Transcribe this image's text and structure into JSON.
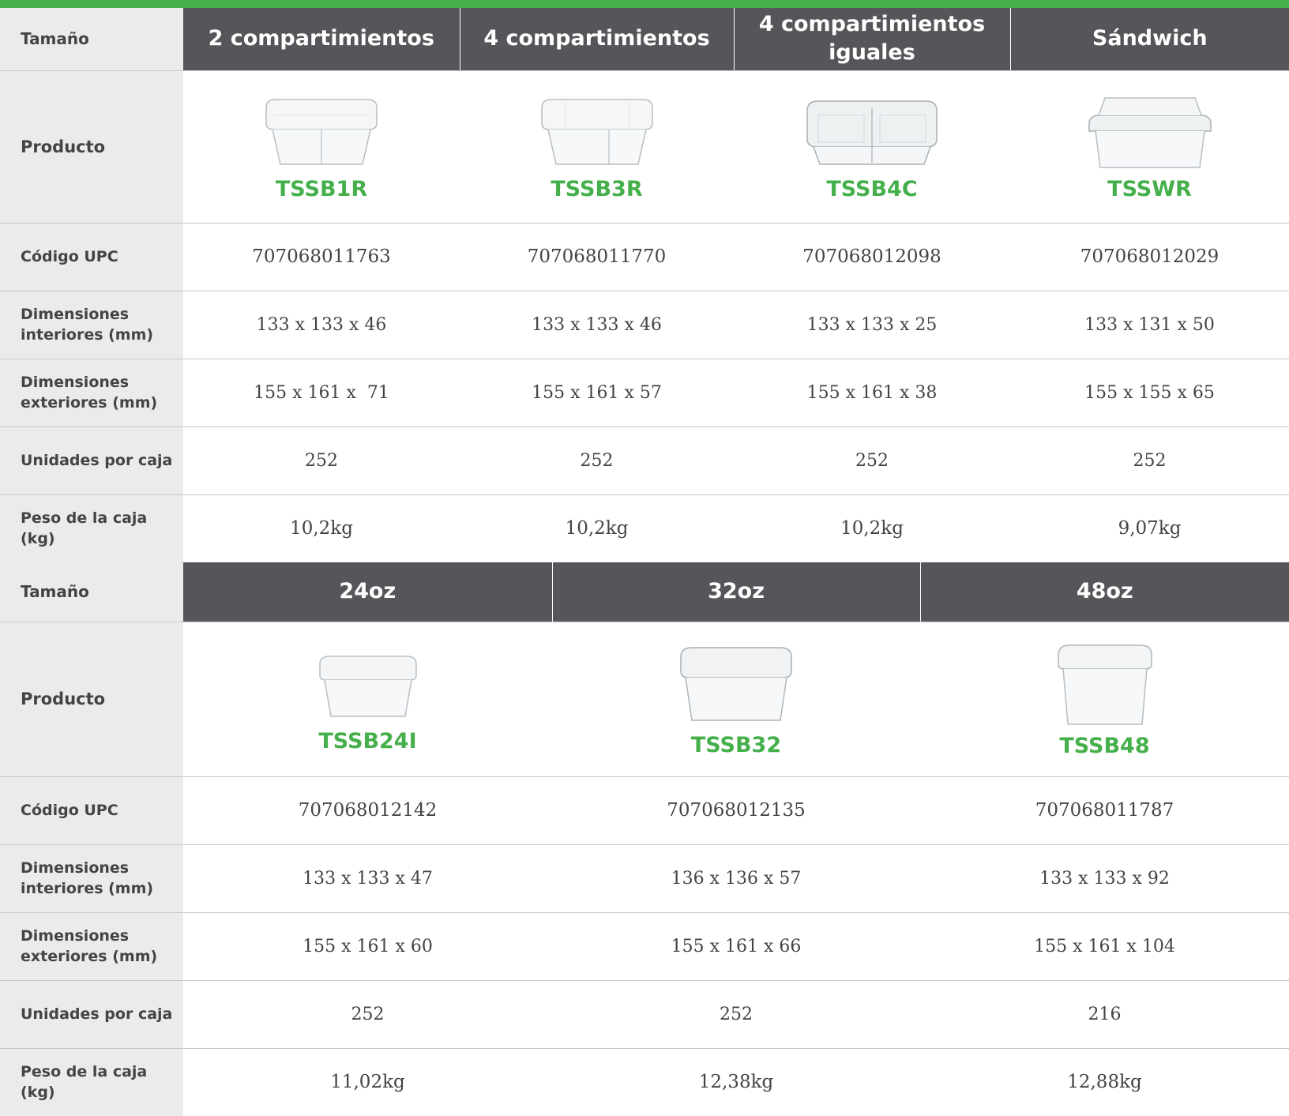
{
  "accent_color": "#45b04b",
  "header_color": "#545659",
  "labels": {
    "size": "Tamaño",
    "product": "Producto",
    "upc": "Código UPC",
    "interior": "Dimensiones interiores (mm)",
    "exterior": "Dimensiones exteriores (mm)",
    "units": "Unidades por caja",
    "weight": "Peso de la caja (kg)"
  },
  "table1": {
    "columns": [
      {
        "size": "2 compartimientos",
        "image_icon": "two-compartment-container-icon",
        "sku": "TSSB1R",
        "upc": "707068011763",
        "interior": "133 x 133 x 46",
        "exterior": "155 x 161 x  71",
        "units": "252",
        "weight": "10,2kg"
      },
      {
        "size": "4 compartimientos",
        "image_icon": "four-compartment-container-icon",
        "sku": "TSSB3R",
        "upc": "707068011770",
        "interior": "133 x 133 x 46",
        "exterior": "155 x 161 x 57",
        "units": "252",
        "weight": "10,2kg"
      },
      {
        "size": "4 compartimientos iguales",
        "image_icon": "four-equal-compartment-container-icon",
        "sku": "TSSB4C",
        "upc": "707068012098",
        "interior": "133 x 133 x 25",
        "exterior": "155 x 161 x 38",
        "units": "252",
        "weight": "10,2kg"
      },
      {
        "size": "Sándwich",
        "image_icon": "sandwich-container-icon",
        "sku": "TSSWR",
        "upc": "707068012029",
        "interior": "133 x 131 x 50",
        "exterior": "155 x 155 x 65",
        "units": "252",
        "weight": "9,07kg"
      }
    ]
  },
  "table2": {
    "columns": [
      {
        "size": "24oz",
        "image_icon": "24oz-container-icon",
        "sku": "TSSB24I",
        "upc": "707068012142",
        "interior": "133 x 133 x 47",
        "exterior": "155 x 161 x 60",
        "units": "252",
        "weight": "11,02kg"
      },
      {
        "size": "32oz",
        "image_icon": "32oz-container-icon",
        "sku": "TSSB32",
        "upc": "707068012135",
        "interior": "136 x 136 x 57",
        "exterior": "155 x 161 x 66",
        "units": "252",
        "weight": "12,38kg"
      },
      {
        "size": "48oz",
        "image_icon": "48oz-container-icon",
        "sku": "TSSB48",
        "upc": "707068011787",
        "interior": "133 x 133 x 92",
        "exterior": "155 x 161 x 104",
        "units": "216",
        "weight": "12,88kg"
      }
    ]
  }
}
